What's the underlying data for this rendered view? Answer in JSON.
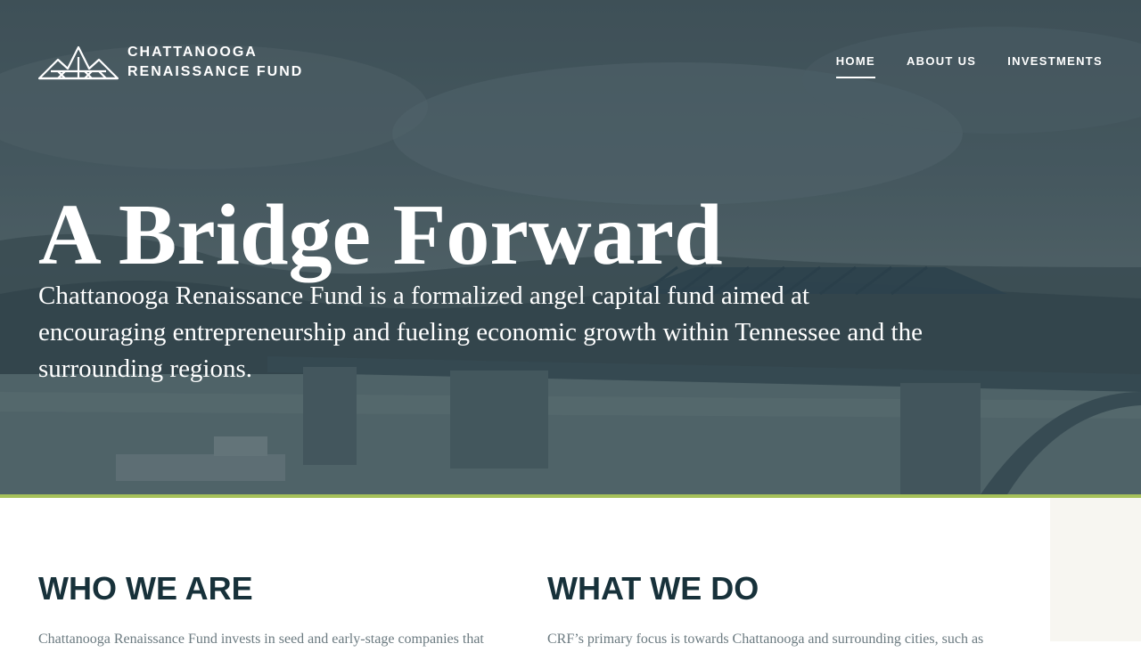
{
  "brand": {
    "line1": "CHATTANOOGA",
    "line2": "RENAISSANCE FUND",
    "logo_icon": "mountains-bridge-icon"
  },
  "nav": {
    "items": [
      {
        "label": "HOME",
        "active": true
      },
      {
        "label": "ABOUT US",
        "active": false
      },
      {
        "label": "INVESTMENTS",
        "active": false
      }
    ]
  },
  "hero": {
    "title": "A Bridge Forward",
    "description": "Chattanooga Renaissance Fund is a formalized angel capital fund aimed at encouraging entrepreneurship and fueling economic growth within Tennessee and the surrounding regions."
  },
  "sections": {
    "who": {
      "heading": "WHO WE ARE",
      "text": "Chattanooga Renaissance Fund invests in seed and early-stage companies that"
    },
    "what": {
      "heading": "WHAT WE DO",
      "text": "CRF’s primary focus is towards Chattanooga and surrounding cities, such as"
    }
  },
  "colors": {
    "accent": "#a6c15a",
    "heading": "#17313a",
    "body_text": "#6b7a80",
    "side_panel": "#f7f6f1"
  }
}
